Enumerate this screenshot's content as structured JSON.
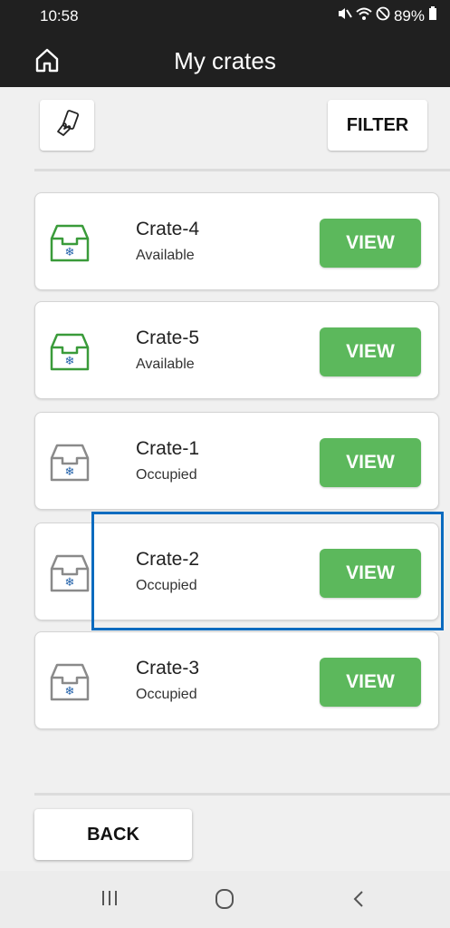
{
  "status_bar": {
    "time": "10:58",
    "battery": "89%",
    "icons": [
      "mute-icon",
      "wifi-icon",
      "do-not-disturb-icon",
      "battery-icon"
    ]
  },
  "app_bar": {
    "title": "My crates",
    "home_icon": "home-icon"
  },
  "toolbar": {
    "scan_icon": "hand-phone-icon",
    "filter_label": "FILTER"
  },
  "crates": [
    {
      "name": "Crate-4",
      "status": "Available",
      "icon_color": "#3a9b3a",
      "view_label": "VIEW"
    },
    {
      "name": "Crate-5",
      "status": "Available",
      "icon_color": "#3a9b3a",
      "view_label": "VIEW"
    },
    {
      "name": "Crate-1",
      "status": "Occupied",
      "icon_color": "#8a8a8a",
      "view_label": "VIEW"
    },
    {
      "name": "Crate-2",
      "status": "Occupied",
      "icon_color": "#8a8a8a",
      "view_label": "VIEW"
    },
    {
      "name": "Crate-3",
      "status": "Occupied",
      "icon_color": "#8a8a8a",
      "view_label": "VIEW"
    }
  ],
  "footer": {
    "back_label": "BACK"
  },
  "nav_bar": {
    "icons": [
      "recent-apps-icon",
      "home-circle-icon",
      "back-chevron-icon"
    ]
  },
  "colors": {
    "accent": "#5cb85c",
    "highlight": "#0b6bbf",
    "header_bg": "#202020"
  }
}
